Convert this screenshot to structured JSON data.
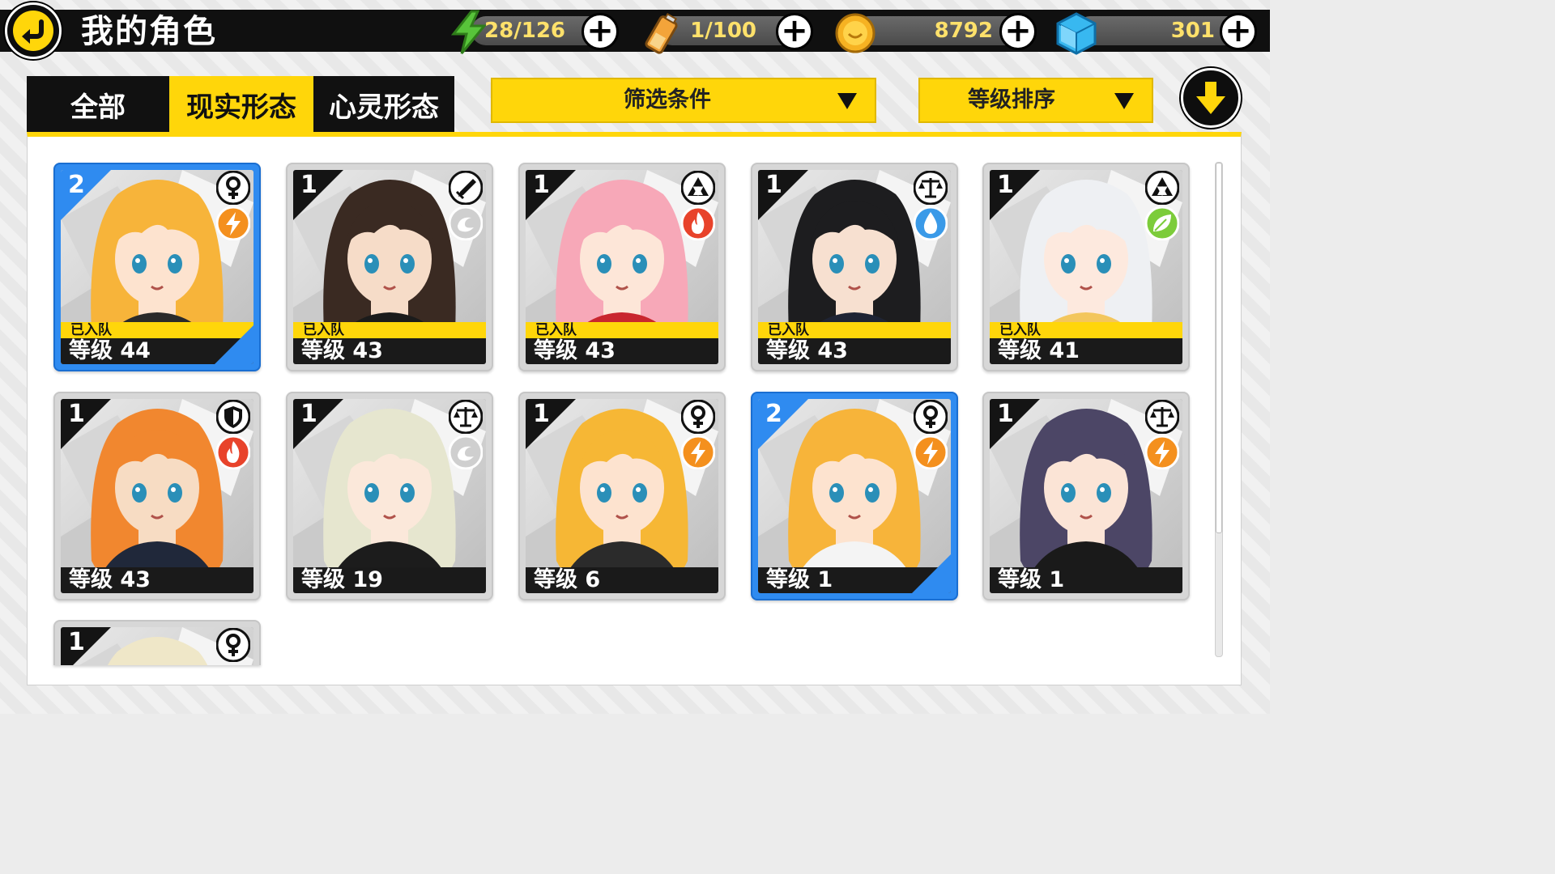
{
  "header": {
    "title": "我的角色",
    "energy": "28/126",
    "battery": "1/100",
    "coins": "8792",
    "gems": "301"
  },
  "tabs": [
    "全部",
    "现实形态",
    "心灵形态"
  ],
  "active_tab": "现实形态",
  "filters": {
    "filter_label": "筛选条件",
    "sort_label": "等级排序"
  },
  "team_label": "已入队",
  "characters": [
    {
      "rank": "2",
      "level": "等级 44",
      "in_team": true,
      "selected": true,
      "type_icon": "female-icon",
      "element_icon": "lightning-icon",
      "hair": "#f7b43a",
      "skin": "#fde3cf",
      "outfit": "#2a2a2a"
    },
    {
      "rank": "1",
      "level": "等级 43",
      "in_team": true,
      "selected": false,
      "type_icon": "sword-icon",
      "element_icon": "wind-icon",
      "hair": "#3a2a22",
      "skin": "#f6dcc8",
      "outfit": "#1b1b1b"
    },
    {
      "rank": "1",
      "level": "等级 43",
      "in_team": true,
      "selected": false,
      "type_icon": "triforce-icon",
      "element_icon": "fire-icon",
      "hair": "#f7a8b8",
      "skin": "#fde6d8",
      "outfit": "#c9262e"
    },
    {
      "rank": "1",
      "level": "等级 43",
      "in_team": true,
      "selected": false,
      "type_icon": "scale-icon",
      "element_icon": "water-icon",
      "hair": "#1d1d1f",
      "skin": "#f7e0d0",
      "outfit": "#1f2434"
    },
    {
      "rank": "1",
      "level": "等级 41",
      "in_team": true,
      "selected": false,
      "type_icon": "triforce-icon",
      "element_icon": "leaf-icon",
      "hair": "#eef0f3",
      "skin": "#fde9de",
      "outfit": "#f3c65c"
    },
    {
      "rank": "1",
      "level": "等级 43",
      "in_team": false,
      "selected": false,
      "type_icon": "shield-icon",
      "element_icon": "fire-icon",
      "hair": "#f1872f",
      "skin": "#f7dcc3",
      "outfit": "#20283a"
    },
    {
      "rank": "1",
      "level": "等级 19",
      "in_team": false,
      "selected": false,
      "type_icon": "scale-icon",
      "element_icon": "wind-icon",
      "hair": "#e6e6cf",
      "skin": "#fbe8da",
      "outfit": "#1c1c1c"
    },
    {
      "rank": "1",
      "level": "等级 6",
      "in_team": false,
      "selected": false,
      "type_icon": "female-icon",
      "element_icon": "lightning-icon",
      "hair": "#f6b735",
      "skin": "#fde3cf",
      "outfit": "#2b2b2b"
    },
    {
      "rank": "2",
      "level": "等级 1",
      "in_team": false,
      "selected": true,
      "type_icon": "female-icon",
      "element_icon": "lightning-icon",
      "hair": "#f7b43a",
      "skin": "#fde3cf",
      "outfit": "#f4f4f4"
    },
    {
      "rank": "1",
      "level": "等级 1",
      "in_team": false,
      "selected": false,
      "type_icon": "scale-icon",
      "element_icon": "lightning-icon",
      "hair": "#4c4666",
      "skin": "#fbe4d6",
      "outfit": "#1a1a1a"
    },
    {
      "rank": "1",
      "level": "",
      "in_team": false,
      "selected": false,
      "type_icon": "female-icon",
      "element_icon": "",
      "hair": "#efe7c8",
      "skin": "#fbe8da",
      "outfit": "#1a1a1a"
    }
  ],
  "colors": {
    "accent_yellow": "#ffd60a",
    "select_blue": "#2f8bf0",
    "top_bar": "#101010"
  }
}
